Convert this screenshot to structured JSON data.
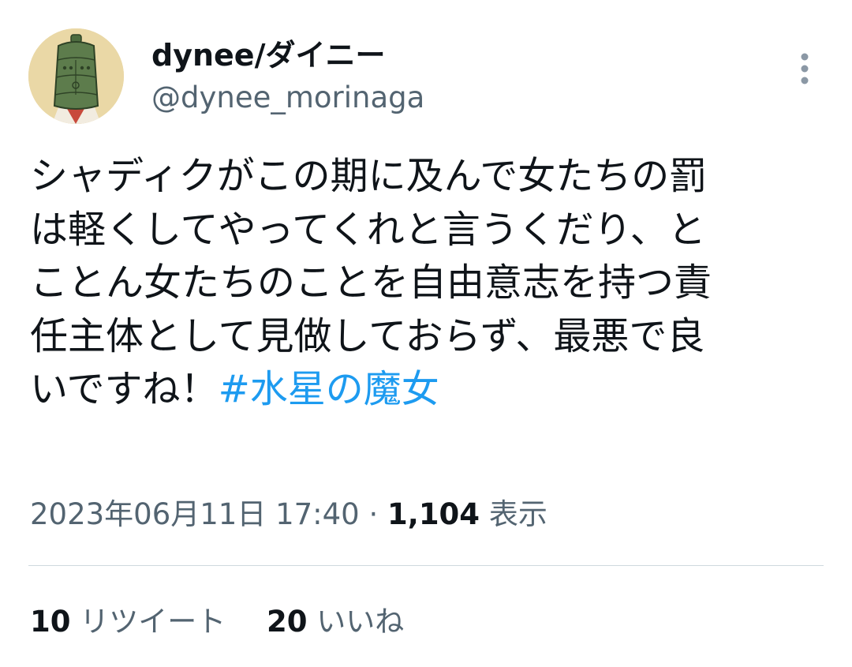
{
  "user": {
    "display_name": "dynee/ダイニー",
    "handle": "@dynee_morinaga",
    "avatar_icon": "bell-avatar-icon"
  },
  "tweet": {
    "lines": [
      "シャディクがこの期に及んで女たちの罰",
      "は軽くしてやってくれと言うくだり、と",
      "ことん女たちのことを自由意志を持つ責",
      "任主体として見做しておらず、最悪で良"
    ],
    "last_line_text": "いですね！",
    "hashtag": "#水星の魔女"
  },
  "meta": {
    "timestamp": "2023年06月11日 17:40",
    "separator": "·",
    "views_count": "1,104",
    "views_label": "表示"
  },
  "stats": {
    "retweets_count": "10",
    "retweets_label": "リツイート",
    "likes_count": "20",
    "likes_label": "いいね"
  },
  "colors": {
    "text": "#0f1419",
    "secondary": "#536471",
    "link": "#1d9bf0",
    "divider": "#cfd9de"
  }
}
